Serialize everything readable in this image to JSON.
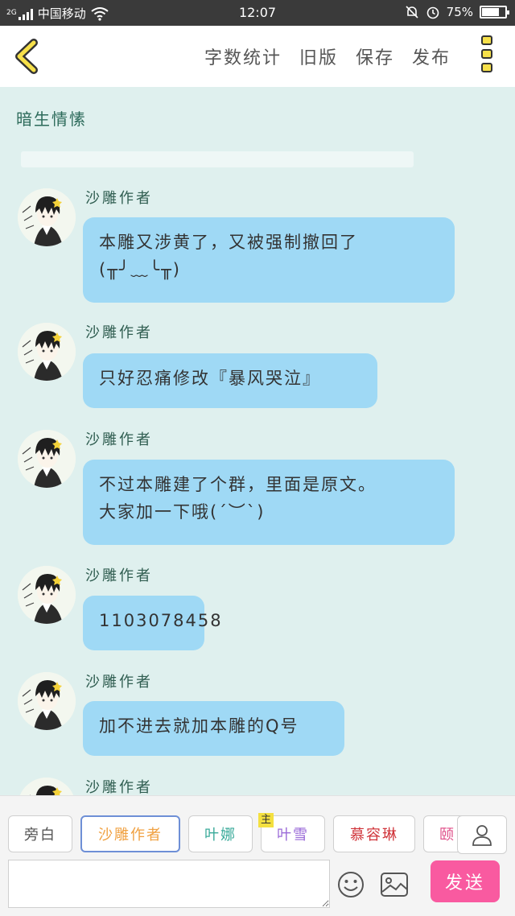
{
  "status_bar": {
    "network_type": "2G",
    "carrier": "中国移动",
    "time": "12:07",
    "battery": "75%",
    "battery_level": 0.75
  },
  "toolbar": {
    "word_count": "字数统计",
    "old_version": "旧版",
    "save": "保存",
    "publish": "发布"
  },
  "story": {
    "title": "暗生情愫"
  },
  "messages": [
    {
      "author": "沙雕作者",
      "text_lines": [
        "本雕又涉黄了，又被强制撤回了",
        "(╥╯﹏╰╥)"
      ]
    },
    {
      "author": "沙雕作者",
      "text_lines": [
        "只好忍痛修改『暴风哭泣』"
      ]
    },
    {
      "author": "沙雕作者",
      "text_lines": [
        "不过本雕建了个群，里面是原文。",
        "大家加一下哦(´︶`)"
      ]
    },
    {
      "author": "沙雕作者",
      "text_lines": [
        "1103078458"
      ]
    },
    {
      "author": "沙雕作者",
      "text_lines": [
        "加不进去就加本雕的Q号"
      ]
    },
    {
      "author": "沙雕作者",
      "text_lines": []
    }
  ],
  "characters": [
    {
      "name": "旁白",
      "color": "#555555",
      "main": false
    },
    {
      "name": "沙雕作者",
      "color": "#f0a040",
      "main": false,
      "selected": true
    },
    {
      "name": "叶娜",
      "color": "#3aaa9a",
      "main": false
    },
    {
      "name": "叶雪",
      "color": "#9a6ad8",
      "main": true,
      "main_label": "主"
    },
    {
      "name": "慕容琳",
      "color": "#d0343a",
      "main": false
    },
    {
      "name": "颐",
      "color": "#e0508a",
      "main": false
    }
  ],
  "composer": {
    "placeholder": "",
    "send_label": "发送"
  },
  "colors": {
    "send": "#f95aa0",
    "bubble": "#9fd9f5",
    "background": "#dff0ee"
  }
}
